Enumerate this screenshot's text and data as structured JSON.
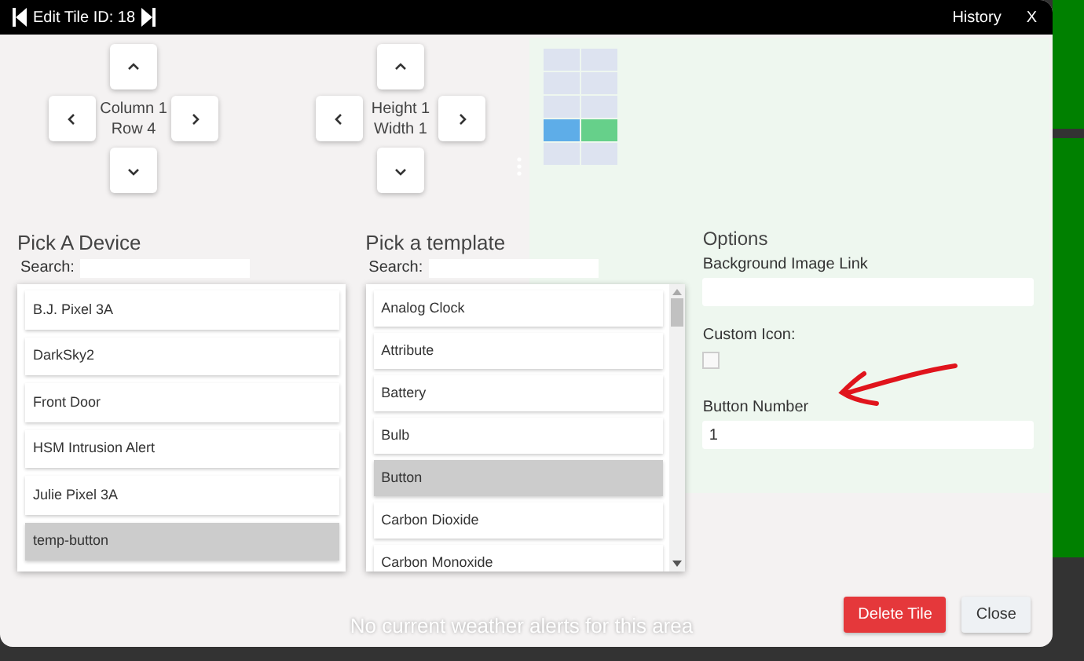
{
  "window": {
    "title": "Edit Tile ID: 18",
    "actions": [
      "History",
      "X"
    ]
  },
  "position_pad": {
    "lines": [
      "Column 1",
      "Row 4"
    ]
  },
  "size_pad": {
    "lines": [
      "Height 1",
      "Width 1"
    ]
  },
  "grid_preview": {
    "rows": [
      {
        "cells": [
          {
            "color": "#dde3f0"
          },
          {
            "color": "#dde3f0"
          }
        ]
      },
      {
        "cells": [
          {
            "color": "#dde3f0"
          },
          {
            "color": "#dde3f0"
          }
        ]
      },
      {
        "cells": [
          {
            "color": "#dde3f0"
          },
          {
            "color": "#dde3f0"
          }
        ]
      },
      {
        "cells": [
          {
            "color": "#5eade8"
          },
          {
            "color": "#66d08a"
          }
        ]
      },
      {
        "cells": [
          {
            "color": "#dde3f0"
          },
          {
            "color": "#dde3f0"
          }
        ]
      }
    ]
  },
  "device_picker": {
    "title": "Pick A Device",
    "search_label": "Search:",
    "items": [
      {
        "label": "B.J. Pixel 3A",
        "selected": false
      },
      {
        "label": "DarkSky2",
        "selected": false
      },
      {
        "label": "Front Door",
        "selected": false
      },
      {
        "label": "HSM Intrusion Alert",
        "selected": false
      },
      {
        "label": "Julie Pixel 3A",
        "selected": false
      },
      {
        "label": "temp-button",
        "selected": true
      }
    ]
  },
  "template_picker": {
    "title": "Pick a template",
    "search_label": "Search:",
    "items": [
      {
        "label": "Analog Clock",
        "selected": false
      },
      {
        "label": "Attribute",
        "selected": false
      },
      {
        "label": "Battery",
        "selected": false
      },
      {
        "label": "Bulb",
        "selected": false
      },
      {
        "label": "Button",
        "selected": true
      },
      {
        "label": "Carbon Dioxide",
        "selected": false
      },
      {
        "label": "Carbon Monoxide",
        "selected": false
      }
    ]
  },
  "options": {
    "title": "Options",
    "fields": [
      {
        "kind": "text",
        "label": "Background Image Link"
      },
      {
        "kind": "checkbox",
        "label": "Custom Icon:",
        "checked": false
      },
      {
        "kind": "text",
        "label": "Button Number",
        "value": "1"
      }
    ]
  },
  "footer_buttons": [
    {
      "label": "Delete Tile",
      "kind": "danger"
    },
    {
      "label": "Close",
      "kind": "secondary"
    }
  ],
  "background_tiles": [
    {
      "kind": "text",
      "text": "No current weather alerts for this area"
    }
  ]
}
